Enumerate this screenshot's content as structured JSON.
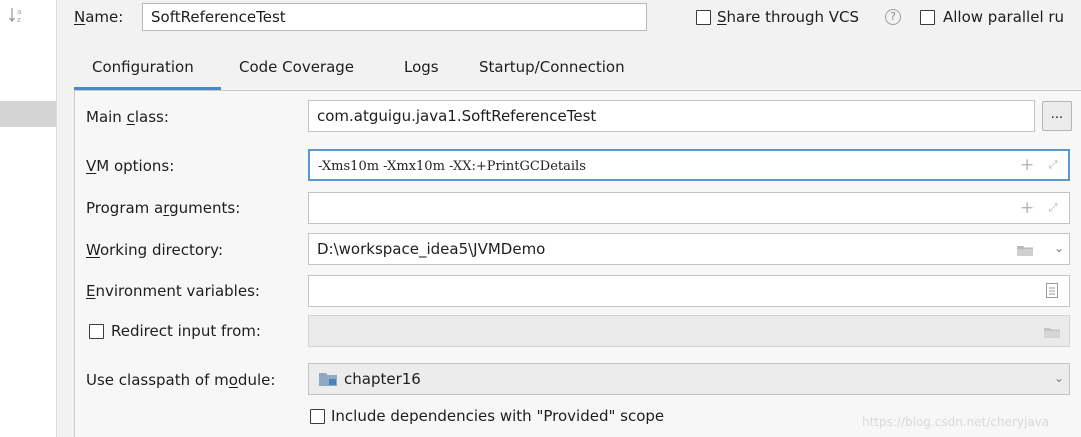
{
  "header": {
    "name_label_mnemonic": "N",
    "name_label_rest": "ame:",
    "name_value": "SoftReferenceTest",
    "vcs_mnemonic": "S",
    "vcs_rest": "hare through VCS",
    "help_glyph": "?",
    "parallel_label": "Allow parallel ru"
  },
  "tabs": [
    {
      "label": "Configuration",
      "selected": true
    },
    {
      "label": "Code Coverage",
      "selected": false
    },
    {
      "label": "Logs",
      "selected": false
    },
    {
      "label": "Startup/Connection",
      "selected": false
    }
  ],
  "form": {
    "main_class": {
      "label_pre": "Main ",
      "label_mn": "c",
      "label_post": "lass:",
      "value": "com.atguigu.java1.SoftReferenceTest",
      "browse_label": "..."
    },
    "vm_options": {
      "label_pre": "",
      "label_mn": "V",
      "label_post": "M options:",
      "value": "-Xms10m -Xmx10m -XX:+PrintGCDetails"
    },
    "program_arguments": {
      "label_pre": "Program a",
      "label_mn": "r",
      "label_post": "guments:",
      "value": ""
    },
    "working_directory": {
      "label_pre": "",
      "label_mn": "W",
      "label_post": "orking directory:",
      "value": "D:\\workspace_idea5\\JVMDemo"
    },
    "environment_variables": {
      "label_pre": "",
      "label_mn": "E",
      "label_post": "nvironment variables:",
      "value": ""
    },
    "redirect_input": {
      "label": "Redirect input from:",
      "checked": false,
      "value": ""
    },
    "classpath_module": {
      "label_pre": "Use classpath of m",
      "label_mn": "o",
      "label_post": "dule:",
      "value": "chapter16"
    },
    "include_dependencies": {
      "label": "Include dependencies with \"Provided\" scope",
      "checked": false
    }
  },
  "icons": {
    "plus": "+",
    "expand": "⤢",
    "chevron": "⌄"
  },
  "watermark": "https://blog.csdn.net/cheryjava",
  "colors": {
    "accent": "#4a88c7",
    "focus_border": "#5d96cf",
    "background": "#f2f2f2",
    "panel": "#f7f7f7"
  }
}
